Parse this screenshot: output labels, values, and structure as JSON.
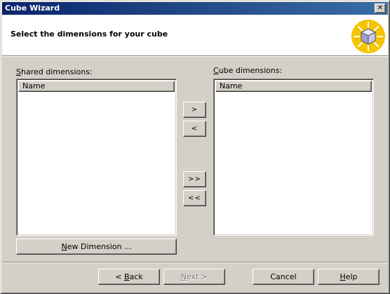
{
  "window": {
    "title": "Cube Wizard",
    "close_glyph": "✕"
  },
  "header": {
    "heading": "Select the dimensions for your cube",
    "icon": "cube-icon"
  },
  "shared": {
    "label_mnemonic": "S",
    "label_rest": "hared dimensions:",
    "column_name": "Name",
    "new_dimension_mnemonic": "N",
    "new_dimension_rest": "ew Dimension ..."
  },
  "cube": {
    "label_mnemonic": "C",
    "label_rest": "ube dimensions:",
    "column_name": "Name"
  },
  "transfer": {
    "add_one": ">",
    "remove_one": "<",
    "add_all": ">>",
    "remove_all": "<<"
  },
  "footer": {
    "back_prefix": "< ",
    "back_mnemonic": "B",
    "back_rest": "ack",
    "next_mnemonic": "N",
    "next_rest": "ext >",
    "cancel": "Cancel",
    "help_mnemonic": "H",
    "help_rest": "elp"
  }
}
